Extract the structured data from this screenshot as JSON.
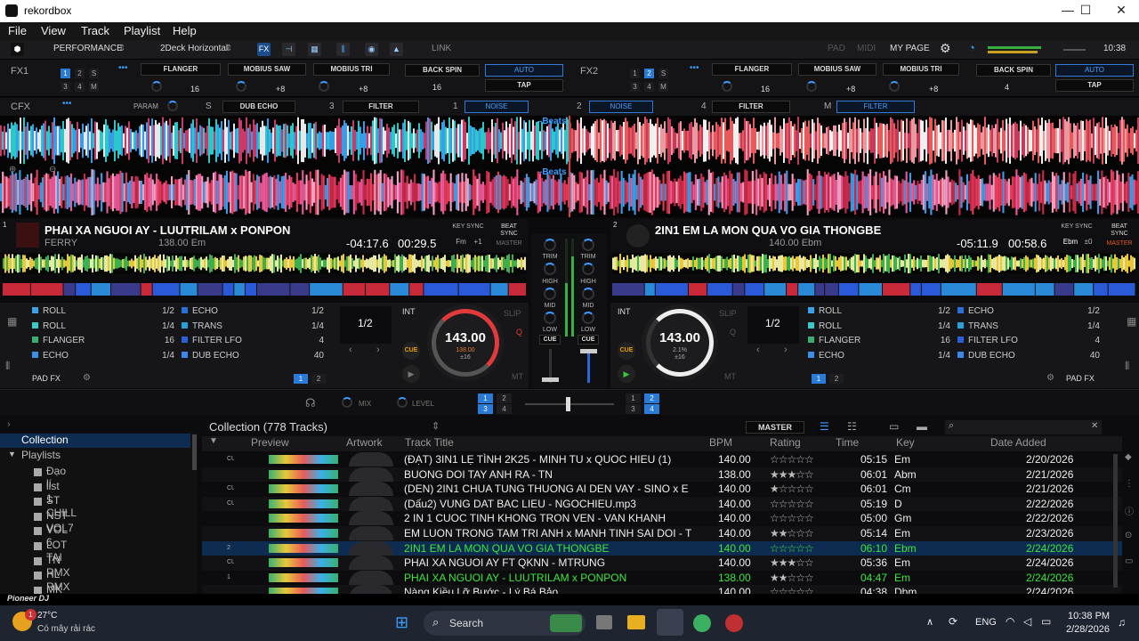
{
  "window": {
    "title": "rekordbox",
    "controls": [
      "—",
      "☐",
      "✕"
    ]
  },
  "menu": [
    "File",
    "View",
    "Track",
    "Playlist",
    "Help"
  ],
  "toolbar": {
    "mode": "PERFORMANCE",
    "layout": "2Deck Horizontal",
    "link": "LINK",
    "pad": "PAD",
    "midi": "MIDI",
    "mypage": "MY PAGE",
    "clock": "10:38"
  },
  "fx1": {
    "label": "FX1",
    "slots": [
      "FLANGER",
      "MOBIUS SAW",
      "MOBIUS TRI"
    ],
    "values": [
      "16",
      "+8",
      "+8"
    ],
    "beatfx": "BACK SPIN",
    "beat_value": "16",
    "auto": "AUTO",
    "tap": "TAP",
    "decks": [
      "1",
      "2",
      "S",
      "3",
      "4",
      "M"
    ]
  },
  "fx2": {
    "label": "FX2",
    "slots": [
      "FLANGER",
      "MOBIUS SAW",
      "MOBIUS TRI"
    ],
    "values": [
      "16",
      "+8",
      "+8"
    ],
    "beatfx": "BACK SPIN",
    "beat_value": "4",
    "auto": "AUTO",
    "tap": "TAP",
    "decks": [
      "1",
      "2",
      "S",
      "3",
      "4",
      "M"
    ]
  },
  "cfx": {
    "label": "CFX",
    "param": "PARAM",
    "s": "S",
    "slots": [
      "DUB ECHO",
      "FILTER",
      "NOISE",
      "NOISE",
      "FILTER",
      "FILTER"
    ],
    "nums": [
      "3",
      "1",
      "2",
      "4"
    ],
    "m": "M"
  },
  "wave": {
    "beats": "-Beats"
  },
  "deck1": {
    "num": "1",
    "title": "PHAI XA NGUOI AY - LUUTRILAM x PONPON",
    "artist": "FERRY",
    "bpmkey": "138.00 Em",
    "remain": "-04:17.6",
    "elapsed": "00:29.5",
    "keysync": "KEY SYNC",
    "key": "Fm",
    "keyshift": "+1",
    "beatsync": "BEAT SYNC",
    "master": "MASTER",
    "bpm": "143.00",
    "bpm_sub": "138.00",
    "range": "±16",
    "beatjump": "1/2",
    "int": "INT",
    "slip": "SLIP",
    "q": "Q",
    "mt": "MT",
    "cue": "CUE",
    "padfx": "PAD FX",
    "pads": [
      {
        "name": "ROLL",
        "val": "1/2",
        "color": "#3aa0e8"
      },
      {
        "name": "ROLL",
        "val": "1/4",
        "color": "#3ac8c8"
      },
      {
        "name": "FLANGER",
        "val": "16",
        "color": "#3ab070"
      },
      {
        "name": "ECHO",
        "val": "1/4",
        "color": "#3a90e8"
      },
      {
        "name": "ECHO",
        "val": "1/2",
        "color": "#2a70d8"
      },
      {
        "name": "TRANS",
        "val": "1/4",
        "color": "#2aa0d8"
      },
      {
        "name": "FILTER LFO",
        "val": "4",
        "color": "#2a60d8"
      },
      {
        "name": "DUB ECHO",
        "val": "40",
        "color": "#3a88e8"
      }
    ],
    "pages": [
      "1",
      "2"
    ]
  },
  "deck2": {
    "num": "2",
    "title": "2IN1 EM LA MON QUA VO GIA THONGBE",
    "artist": "",
    "bpmkey": "140.00 Ebm",
    "remain": "-05:11.9",
    "elapsed": "00:58.6",
    "keysync": "KEY SYNC",
    "key": "Ebm",
    "keyshift": "±0",
    "beatsync": "BEAT SYNC",
    "master": "MASTER",
    "bpm": "143.00",
    "bpm_sub": "2.1%",
    "range": "±16",
    "beatjump": "1/2",
    "int": "INT",
    "slip": "SLIP",
    "q": "Q",
    "mt": "MT",
    "cue": "CUE",
    "padfx": "PAD FX",
    "pads": [
      {
        "name": "ROLL",
        "val": "1/2",
        "color": "#3aa0e8"
      },
      {
        "name": "ROLL",
        "val": "1/4",
        "color": "#3ac8c8"
      },
      {
        "name": "FLANGER",
        "val": "16",
        "color": "#3ab070"
      },
      {
        "name": "ECHO",
        "val": "1/4",
        "color": "#3a90e8"
      },
      {
        "name": "ECHO",
        "val": "1/2",
        "color": "#2a70d8"
      },
      {
        "name": "TRANS",
        "val": "1/4",
        "color": "#2aa0d8"
      },
      {
        "name": "FILTER LFO",
        "val": "4",
        "color": "#2a60d8"
      },
      {
        "name": "DUB ECHO",
        "val": "40",
        "color": "#3a88e8"
      }
    ],
    "pages": [
      "1",
      "2"
    ]
  },
  "mixer": {
    "trim": "TRIM",
    "high": "HIGH",
    "mid": "MID",
    "low": "LOW",
    "cue": "CUE"
  },
  "bottom": {
    "mix": "MIX",
    "level": "LEVEL"
  },
  "browser": {
    "heading": "Collection (778 Tracks)",
    "master": "MASTER",
    "tree": [
      "Collection",
      "Playlists",
      "Đạo lí",
      "list 1",
      "ST CHILL",
      "NST VOL7",
      "VOL 6",
      "LOT TAI",
      "TN RMX",
      "HL RMX",
      "MK RMX"
    ],
    "columns": [
      "Preview",
      "Artwork",
      "Track Title",
      "BPM",
      "Rating",
      "Time",
      "Key",
      "Date Added"
    ],
    "rows": [
      {
        "flag": "CUE",
        "title": "(ĐẠT) 3IN1 LẸ TÌNH 2K25 - MINH TU x QUOC HIEU (1)",
        "bpm": "140.00",
        "rating": 0,
        "time": "05:15",
        "key": "Em",
        "date": "2/20/2026"
      },
      {
        "flag": "",
        "title": "BUONG DOI TAY ANH RA - TN",
        "bpm": "138.00",
        "rating": 3,
        "time": "06:01",
        "key": "Abm",
        "date": "2/21/2026"
      },
      {
        "flag": "CUE",
        "title": "(DEN) 2IN1 CHUA TUNG THUONG AI DEN VAY - SINO x E",
        "bpm": "140.00",
        "rating": 1,
        "time": "06:01",
        "key": "Cm",
        "date": "2/21/2026"
      },
      {
        "flag": "CUE",
        "title": "(Dấu2) VUNG DAT BAC LIEU  - NGOCHIEU.mp3",
        "bpm": "140.00",
        "rating": 0,
        "time": "05:19",
        "key": "D",
        "date": "2/22/2026"
      },
      {
        "flag": "",
        "title": "2 IN 1 CUOC TINH KHONG TRON VEN - VAN KHANH",
        "bpm": "140.00",
        "rating": 0,
        "time": "05:00",
        "key": "Gm",
        "date": "2/22/2026"
      },
      {
        "flag": "",
        "title": "EM LUON TRONG TAM TRI ANH x MANH TINH SAI DOI - T",
        "bpm": "140.00",
        "rating": 2,
        "time": "05:14",
        "key": "Em",
        "date": "2/23/2026"
      },
      {
        "flag": "2",
        "title": "2IN1 EM LA MON QUA VO GIA THONGBE",
        "bpm": "140.00",
        "rating": 0,
        "time": "06:10",
        "key": "Ebm",
        "date": "2/24/2026"
      },
      {
        "flag": "CUE",
        "title": "PHAI XA NGUOI AY FT QKNN - MTRUNG",
        "bpm": "140.00",
        "rating": 3,
        "time": "05:36",
        "key": "Em",
        "date": "2/24/2026"
      },
      {
        "flag": "1",
        "title": "PHAI XA NGUOI AY - LUUTRILAM x PONPON",
        "bpm": "138.00",
        "rating": 2,
        "time": "04:47",
        "key": "Em",
        "date": "2/24/2026"
      },
      {
        "flag": "",
        "title": "Nàng Kiều Lỡ Bước - Lý Bá Bảo",
        "bpm": "140.00",
        "rating": 0,
        "time": "04:38",
        "key": "Dbm",
        "date": "2/24/2026"
      }
    ]
  },
  "pioneer": "Pioneer DJ",
  "taskbar": {
    "temp": "27°C",
    "weather": "Có mây rải rác",
    "search": "Search",
    "lang": "ENG",
    "time": "10:38 PM",
    "date": "2/28/2026",
    "badge": "1"
  }
}
